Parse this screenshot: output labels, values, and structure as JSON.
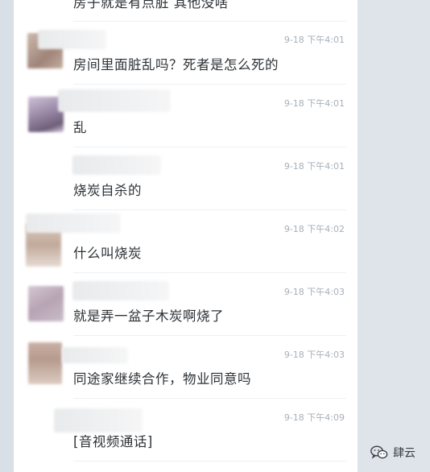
{
  "messages": [
    {
      "text": "房子就是有点脏 其他没啥",
      "time": ""
    },
    {
      "text": "房间里面脏乱吗？死者是怎么死的",
      "time": "9-18 下午4:01"
    },
    {
      "text": "乱",
      "time": "9-18 下午4:01"
    },
    {
      "text": "烧炭自杀的",
      "time": "9-18 下午4:01"
    },
    {
      "text": "什么叫烧炭",
      "time": "9-18 下午4:02"
    },
    {
      "text": "就是弄一盆子木炭啊烧了",
      "time": "9-18 下午4:03"
    },
    {
      "text": "同途家继续合作，物业同意吗",
      "time": "9-18 下午4:03"
    },
    {
      "text": "[音视频通话]",
      "time": "9-18 下午4:09"
    }
  ],
  "watermark": {
    "label": "肆云",
    "icon": "wechat-icon"
  },
  "colors": {
    "text": "#2d3236",
    "time": "#a7b0ba",
    "background": "#d9dfe6",
    "panel": "#ffffff"
  }
}
